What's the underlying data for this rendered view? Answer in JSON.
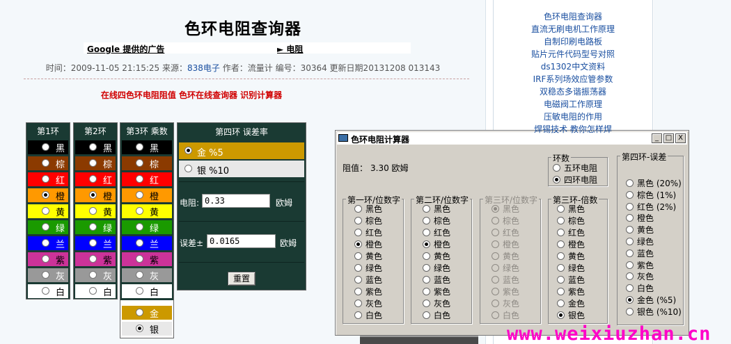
{
  "page": {
    "title": "色环电阻查询器",
    "ad_label": "Google 提供的广告",
    "ad_link": "► 电阻",
    "meta_time": "时间：2009-11-05 21:15:25",
    "meta_source_label": "来源：",
    "meta_source": "838电子",
    "meta_rest": "作者：流量计   编号：30364   更新日期20131208 013143",
    "promo": "在线四色环电阻阻值 色环在线查询器 识别计算器"
  },
  "sidebar": {
    "links": [
      "色环电阻查询器",
      "直流无刷电机工作原理",
      "自制印刷电路板",
      "贴片元件代码型号对照",
      "ds1302中文资料",
      "IRF系列场效应管参数",
      "双稳态多谐振荡器",
      "电磁阀工作原理",
      "压敏电阻的作用",
      "焊锡技术 教你怎样焊"
    ]
  },
  "bands": {
    "col1_header": "第1环",
    "col2_header": "第2环",
    "col3_header": "第3环 乘数",
    "colors": [
      {
        "label": "黑",
        "bg": "#000000",
        "fg": "#ffffff"
      },
      {
        "label": "棕",
        "bg": "#8b3a00",
        "fg": "#ffffff"
      },
      {
        "label": "红",
        "bg": "#ff0000",
        "fg": "#ffffff"
      },
      {
        "label": "橙",
        "bg": "#ff9900",
        "fg": "#000000"
      },
      {
        "label": "黄",
        "bg": "#ffff00",
        "fg": "#000000"
      },
      {
        "label": "绿",
        "bg": "#1a9a00",
        "fg": "#ffffff"
      },
      {
        "label": "兰",
        "bg": "#0000ff",
        "fg": "#ffffff"
      },
      {
        "label": "紫",
        "bg": "#cc3399",
        "fg": "#000000"
      },
      {
        "label": "灰",
        "bg": "#999999",
        "fg": "#ffffff"
      },
      {
        "label": "白",
        "bg": "#ffffff",
        "fg": "#000000"
      }
    ],
    "col1_selected": "橙",
    "col2_selected": "橙",
    "col3_selected": "银",
    "col3_extra": [
      {
        "label": "金",
        "bg": "#cc9900",
        "fg": "#ffffff"
      },
      {
        "label": "银",
        "bg": "#e8e8e8",
        "fg": "#000000"
      }
    ]
  },
  "tolerance_panel": {
    "header": "第四环 误差率",
    "gold": "金 %5",
    "silver": "银 %10",
    "selected": "金",
    "resistance_label": "电阻:",
    "resistance_value": "0.33",
    "resistance_unit": "欧姆",
    "error_label": "误差±",
    "error_value": "0.0165",
    "error_unit": "欧姆",
    "reset_label": "重置"
  },
  "dialog": {
    "title": "色环电阻计算器",
    "value_label": "阻值：",
    "value": "3.30 欧姆",
    "rings_group": "环数",
    "rings_options": [
      "五环电阻",
      "四环电阻"
    ],
    "rings_selected": "四环电阻",
    "g1": "第一环/位数字",
    "g2": "第二环/位数字",
    "g3": "第三环/位数字",
    "g4": "第三环-倍数",
    "g5": "第四环-误差",
    "digits": [
      "黑色",
      "棕色",
      "红色",
      "橙色",
      "黄色",
      "绿色",
      "蓝色",
      "紫色",
      "灰色",
      "白色"
    ],
    "g1_selected": "橙色",
    "g2_selected": "橙色",
    "g3_selected": "黑色",
    "multipliers": [
      "黑色",
      "棕色",
      "红色",
      "橙色",
      "黄色",
      "绿色",
      "蓝色",
      "紫色",
      "金色",
      "银色"
    ],
    "g4_selected": "银色",
    "tolerances": [
      "黑色 (20%)",
      "棕色 (1%)",
      "红色 (2%)",
      "橙色",
      "黄色",
      "绿色",
      "蓝色",
      "紫色",
      "灰色",
      "白色",
      "金色 (%5)",
      "银色 (%10)"
    ],
    "g5_selected": "金色 (%5)",
    "min_label": "_",
    "max_label": "□",
    "close_label": "X"
  },
  "watermark": "www.weixiuzhan.cn"
}
